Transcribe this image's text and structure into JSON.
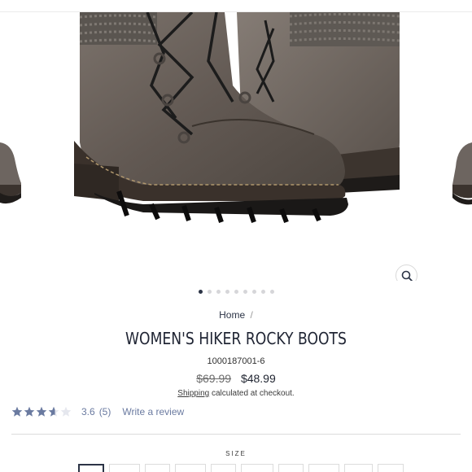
{
  "product": {
    "title": "WOMEN'S HIKER ROCKY BOOTS",
    "sku": "1000187001-6",
    "original_price": "$69.99",
    "sale_price": "$48.99",
    "image_alt": "Women's hiker boots in grey with knit cuff"
  },
  "breadcrumb": {
    "home": "Home",
    "separator": "/"
  },
  "shipping": {
    "link_label": "Shipping",
    "text": "calculated at checkout."
  },
  "reviews": {
    "rating": "3.6",
    "count": "(5)",
    "stars_filled": 3.6,
    "stars_total": 5,
    "write_review_label": "Write a review"
  },
  "gallery": {
    "slide_count": 9,
    "active_slide": 0
  },
  "size": {
    "label": "SIZE",
    "option_count": 10
  },
  "colors": {
    "navy": "#2c3446",
    "star_color": "#6a7aa0",
    "star_empty": "#e5e7ee"
  },
  "icons": {
    "zoom": "magnifier-icon"
  }
}
